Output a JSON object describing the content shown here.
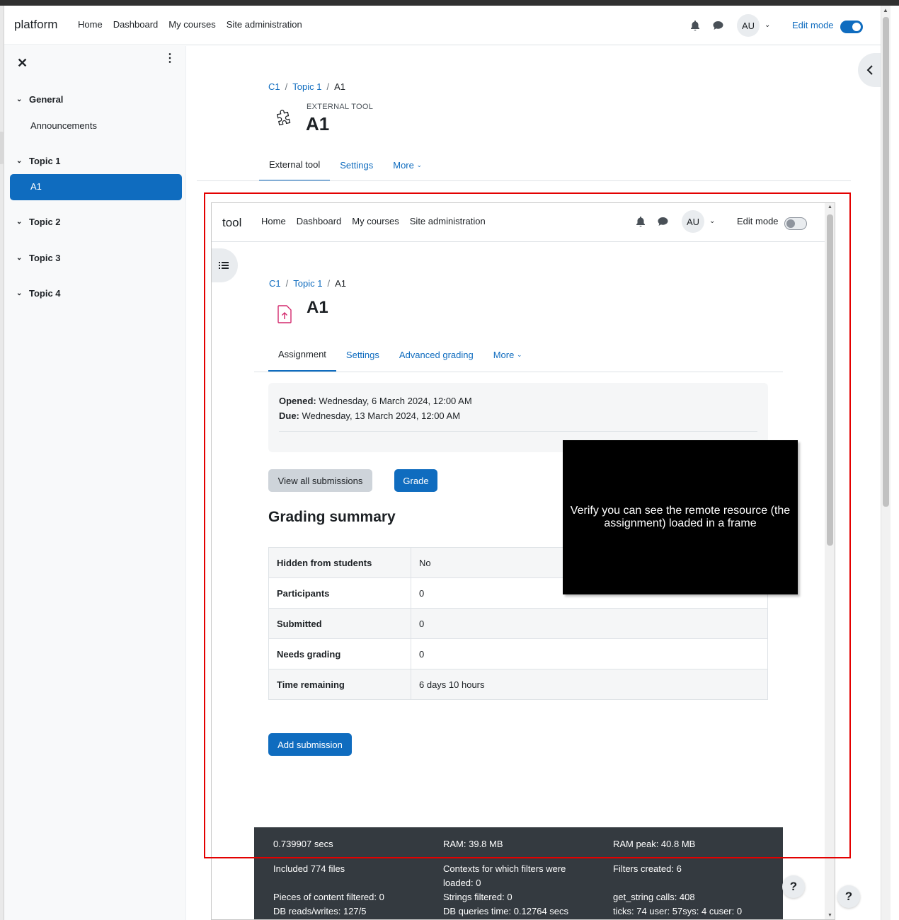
{
  "outer": {
    "brand": "platform",
    "nav": [
      "Home",
      "Dashboard",
      "My courses",
      "Site administration"
    ],
    "avatar": "AU",
    "edit_mode_label": "Edit mode",
    "edit_mode_on": true
  },
  "drawer": {
    "sections": [
      {
        "title": "General",
        "items": [
          "Announcements"
        ]
      },
      {
        "title": "Topic 1",
        "items": [
          "A1"
        ]
      },
      {
        "title": "Topic 2",
        "items": []
      },
      {
        "title": "Topic 3",
        "items": []
      },
      {
        "title": "Topic 4",
        "items": []
      }
    ],
    "active_item": "A1"
  },
  "page": {
    "breadcrumb": [
      "C1",
      "Topic 1",
      "A1"
    ],
    "module_type": "EXTERNAL TOOL",
    "title": "A1",
    "tabs": [
      "External tool",
      "Settings",
      "More"
    ],
    "active_tab": "External tool"
  },
  "frame": {
    "brand": "tool",
    "nav": [
      "Home",
      "Dashboard",
      "My courses",
      "Site administration"
    ],
    "avatar": "AU",
    "edit_mode_label": "Edit mode",
    "edit_mode_on": false,
    "breadcrumb": [
      "C1",
      "Topic 1",
      "A1"
    ],
    "title": "A1",
    "tabs": [
      "Assignment",
      "Settings",
      "Advanced grading",
      "More"
    ],
    "active_tab": "Assignment",
    "dates": {
      "opened_label": "Opened:",
      "opened_value": "Wednesday, 6 March 2024, 12:00 AM",
      "due_label": "Due:",
      "due_value": "Wednesday, 13 March 2024, 12:00 AM"
    },
    "buttons": {
      "view_all": "View all submissions",
      "grade": "Grade",
      "add_submission": "Add submission"
    },
    "grading_summary_title": "Grading summary",
    "summary_rows": [
      [
        "Hidden from students",
        "No"
      ],
      [
        "Participants",
        "0"
      ],
      [
        "Submitted",
        "0"
      ],
      [
        "Needs grading",
        "0"
      ],
      [
        "Time remaining",
        "6 days 10 hours"
      ]
    ],
    "popup_text": "Verify you can see the remote resource (the assignment) loaded in a frame",
    "perf": [
      "0.739907 secs",
      "RAM: 39.8 MB",
      "RAM peak: 40.8 MB",
      "Included 774 files",
      "Contexts for which filters were loaded: 0",
      "Filters created: 6",
      "Pieces of content filtered: 0",
      "Strings filtered: 0",
      "get_string calls: 408",
      "DB reads/writes: 127/5",
      "DB queries time: 0.12764 secs",
      "ticks: 74 user: 57sys: 4 cuser: 0"
    ]
  },
  "help_label": "?",
  "colors": {
    "primary": "#0f6cbf",
    "highlight_border": "#e30000",
    "footer_bg": "#343a40"
  }
}
